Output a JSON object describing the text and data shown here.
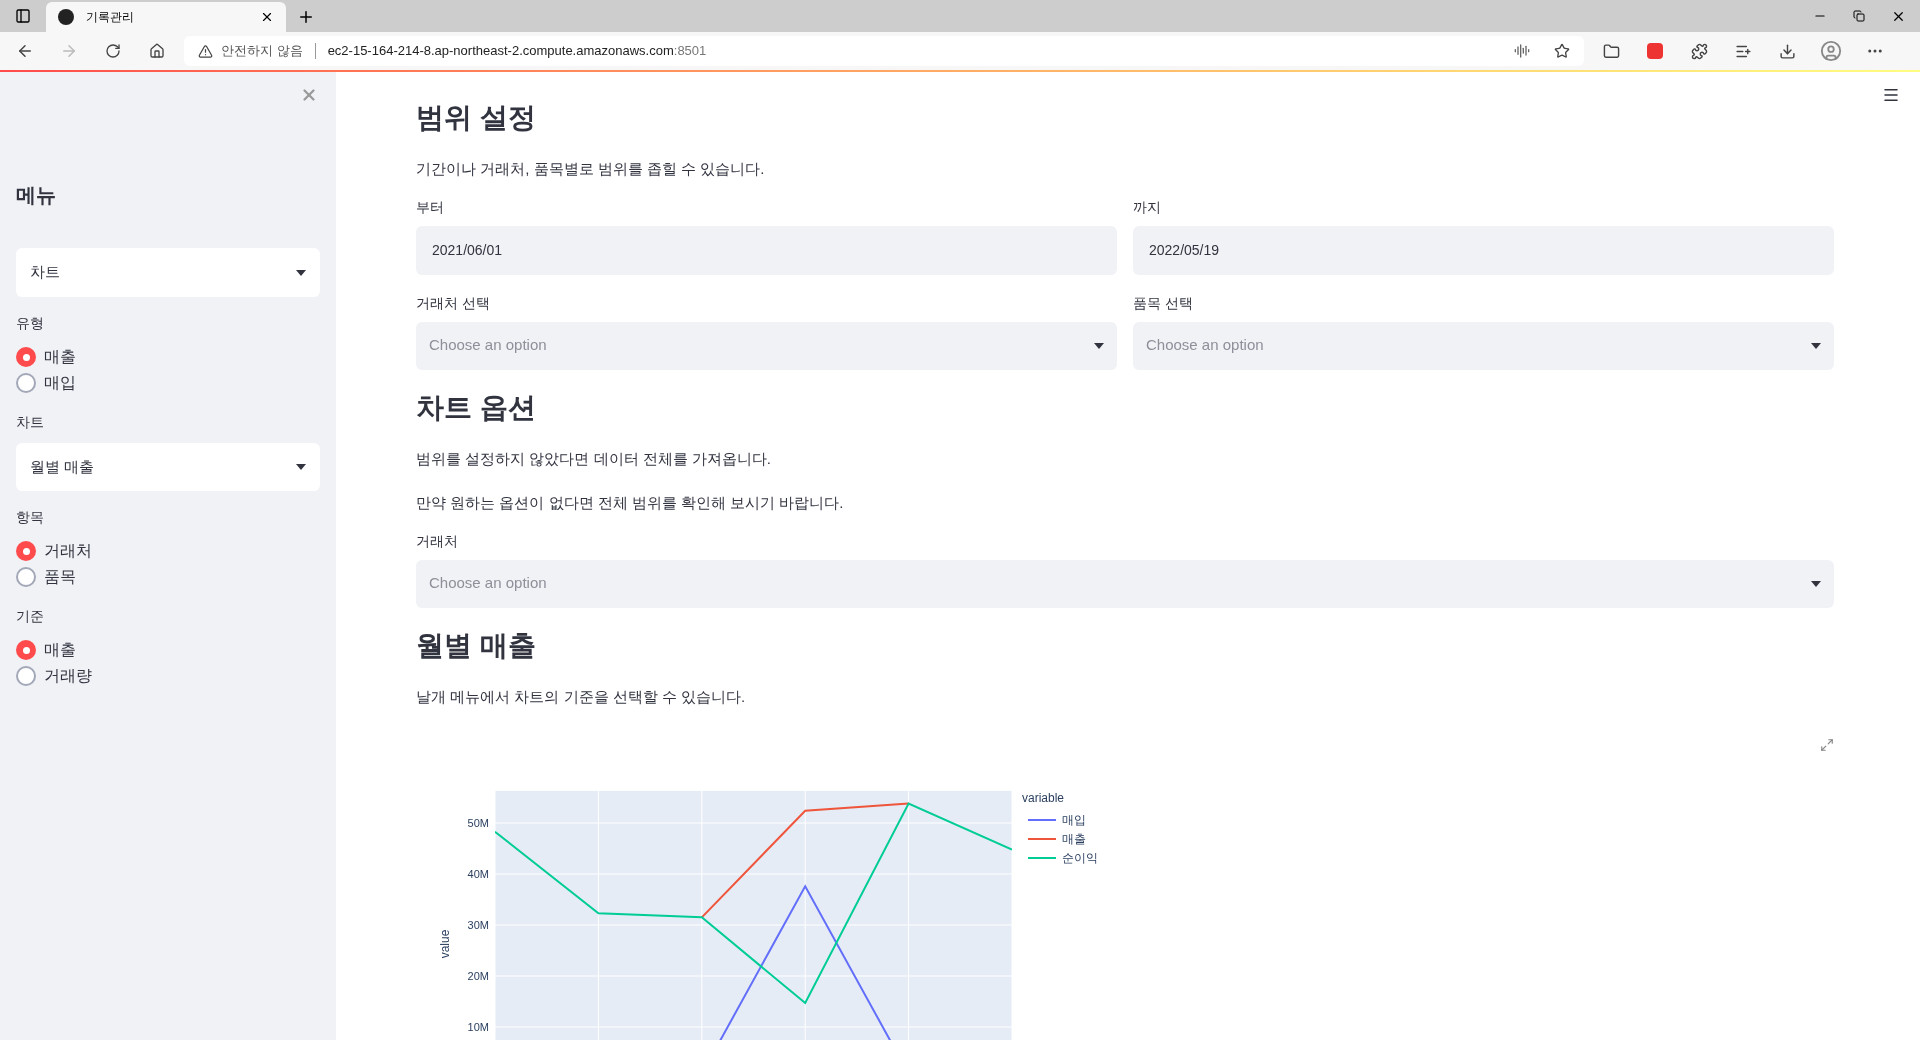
{
  "browser": {
    "tab_title": "기록관리",
    "security_label": "안전하지 않음",
    "url_host": "ec2-15-164-214-8.ap-northeast-2.compute.amazonaws.com",
    "url_port": ":8501"
  },
  "sidebar": {
    "title": "메뉴",
    "page_select": "차트",
    "groups": [
      {
        "kind": "radio",
        "label": "유형",
        "options": [
          {
            "label": "매출",
            "selected": true
          },
          {
            "label": "매입",
            "selected": false
          }
        ]
      },
      {
        "kind": "select",
        "label": "차트",
        "value": "월별 매출"
      },
      {
        "kind": "radio",
        "label": "항목",
        "options": [
          {
            "label": "거래처",
            "selected": true
          },
          {
            "label": "품목",
            "selected": false
          }
        ]
      },
      {
        "kind": "radio",
        "label": "기준",
        "options": [
          {
            "label": "매출",
            "selected": true
          },
          {
            "label": "거래량",
            "selected": false
          }
        ]
      }
    ]
  },
  "sections": [
    {
      "heading": "범위 설정",
      "texts": [
        "기간이나 거래처, 품목별로 범위를 좁힐 수 있습니다."
      ],
      "fields": [
        {
          "kind": "date",
          "label": "부터",
          "value": "2021/06/01"
        },
        {
          "kind": "date",
          "label": "까지",
          "value": "2022/05/19"
        },
        {
          "kind": "select",
          "label": "거래처 선택",
          "placeholder": "Choose an option"
        },
        {
          "kind": "select",
          "label": "품목 선택",
          "placeholder": "Choose an option"
        }
      ]
    },
    {
      "heading": "차트 옵션",
      "texts": [
        "범위를 설정하지 않았다면 데이터 전체를 가져옵니다.",
        "만약 원하는 옵션이 없다면 전체 범위를 확인해 보시기 바랍니다."
      ],
      "fields": [
        {
          "kind": "select",
          "label": "거래처",
          "placeholder": "Choose an option",
          "wide": true
        }
      ]
    },
    {
      "heading": "월별 매출",
      "texts": [
        "날개 메뉴에서 차트의 기준을 선택할 수 있습니다."
      ]
    }
  ],
  "chart_data": {
    "type": "line",
    "ylabel": "value",
    "ylim": [
      0,
      56.3
    ],
    "yticks": [
      {
        "value": 10,
        "label": "10M"
      },
      {
        "value": 20,
        "label": "20M"
      },
      {
        "value": 30,
        "label": "30M"
      },
      {
        "value": 40,
        "label": "40M"
      },
      {
        "value": 50,
        "label": "50M"
      }
    ],
    "grid": true,
    "legend": {
      "title": "variable"
    },
    "series": [
      {
        "name": "매입",
        "color": "#636efa",
        "values": [
          null,
          null,
          0.8,
          37.6,
          0.8,
          null
        ]
      },
      {
        "name": "매출",
        "color": "#ef553b",
        "values": [
          null,
          null,
          31.5,
          52.4,
          53.8,
          null
        ]
      },
      {
        "name": "순이익",
        "color": "#00cc96",
        "values": [
          48.3,
          32.3,
          31.5,
          14.7,
          53.8,
          44.8
        ]
      }
    ]
  }
}
